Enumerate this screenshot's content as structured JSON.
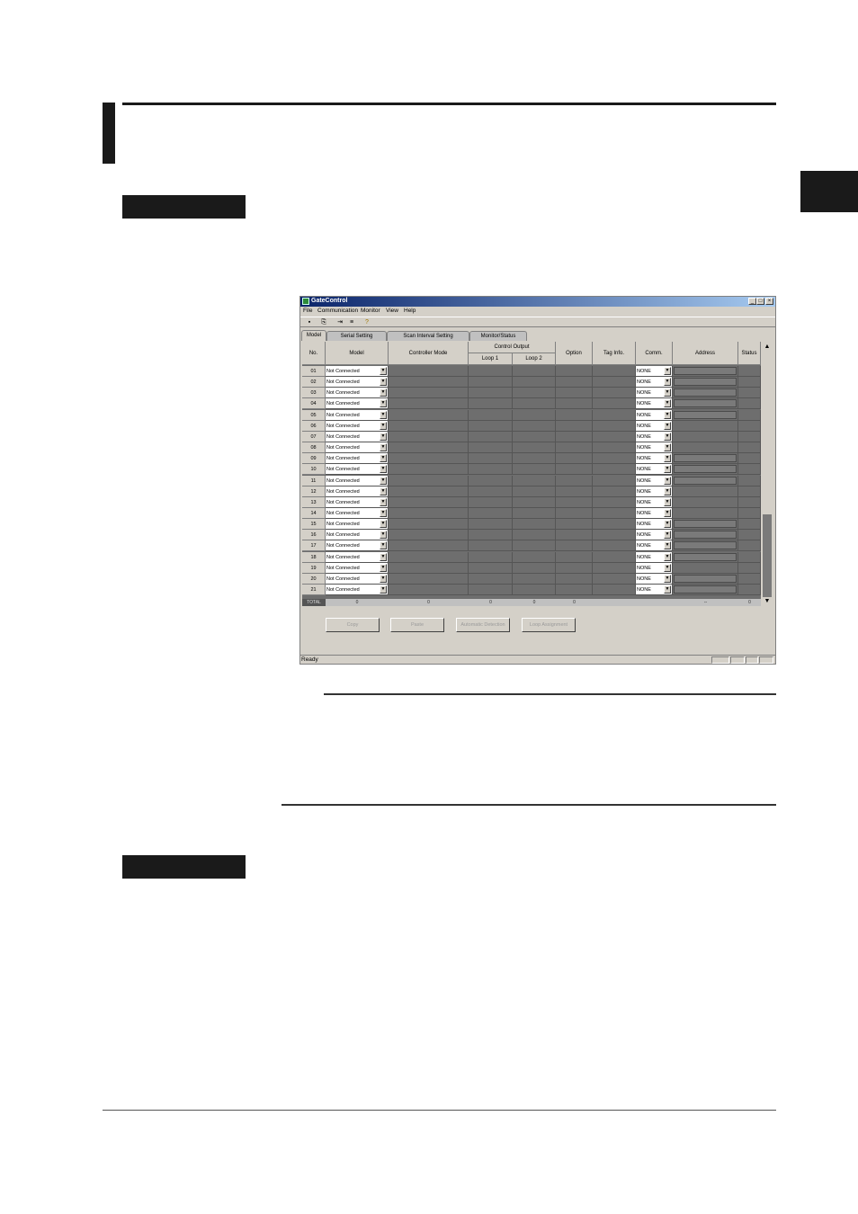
{
  "window": {
    "title": "GateControl",
    "menu": [
      "File",
      "Communication",
      "Monitor",
      "View",
      "Help"
    ],
    "tabs": [
      "Model",
      "Serial Setting",
      "Scan Interval Setting",
      "Monitor/Status"
    ],
    "active_tab": "Model",
    "toolbar_icons": [
      "save-icon",
      "export-icon",
      "import-icon",
      "list-icon",
      "help-icon"
    ]
  },
  "grid": {
    "headers": {
      "no": "No.",
      "model": "Model",
      "controller_mode": "Controller Mode",
      "control_output": "Control Output",
      "loop1": "Loop 1",
      "loop2": "Loop 2",
      "option": "Option",
      "tag_info": "Tag Info.",
      "comm": "Comm.",
      "address": "Address",
      "status": "Status"
    },
    "rows": [
      {
        "no": "01",
        "model": "Not Connected",
        "comm": "NONE"
      },
      {
        "no": "02",
        "model": "Not Connected",
        "comm": "NONE"
      },
      {
        "no": "03",
        "model": "Not Connected",
        "comm": "NONE"
      },
      {
        "no": "04",
        "model": "Not Connected",
        "comm": "NONE"
      },
      {
        "no": "05",
        "model": "Not Connected",
        "comm": "NONE"
      },
      {
        "no": "06",
        "model": "Not Connected",
        "comm": "NONE"
      },
      {
        "no": "07",
        "model": "Not Connected",
        "comm": "NONE"
      },
      {
        "no": "08",
        "model": "Not Connected",
        "comm": "NONE"
      },
      {
        "no": "09",
        "model": "Not Connected",
        "comm": "NONE"
      },
      {
        "no": "10",
        "model": "Not Connected",
        "comm": "NONE"
      },
      {
        "no": "11",
        "model": "Not Connected",
        "comm": "NONE"
      },
      {
        "no": "12",
        "model": "Not Connected",
        "comm": "NONE"
      },
      {
        "no": "13",
        "model": "Not Connected",
        "comm": "NONE"
      },
      {
        "no": "14",
        "model": "Not Connected",
        "comm": "NONE"
      },
      {
        "no": "15",
        "model": "Not Connected",
        "comm": "NONE"
      },
      {
        "no": "16",
        "model": "Not Connected",
        "comm": "NONE"
      },
      {
        "no": "17",
        "model": "Not Connected",
        "comm": "NONE"
      },
      {
        "no": "18",
        "model": "Not Connected",
        "comm": "NONE"
      },
      {
        "no": "19",
        "model": "Not Connected",
        "comm": "NONE"
      },
      {
        "no": "20",
        "model": "Not Connected",
        "comm": "NONE"
      },
      {
        "no": "21",
        "model": "Not Connected",
        "comm": "NONE"
      }
    ],
    "totals": {
      "label": "TOTAL",
      "model": "0",
      "controller_mode": "0",
      "loop1": "0",
      "loop2": "0",
      "option": "0",
      "address": "--",
      "status": "0"
    }
  },
  "buttons": [
    "Copy",
    "Paste",
    "Automatic Detection",
    "Loop Assignment"
  ],
  "status_bar": "Ready",
  "colors": {
    "window_face": "#d4d0c8",
    "grid_disabled": "#6e6e6e",
    "title_gradient_start": "#0a246a",
    "page_ink": "#1a1a1a"
  }
}
